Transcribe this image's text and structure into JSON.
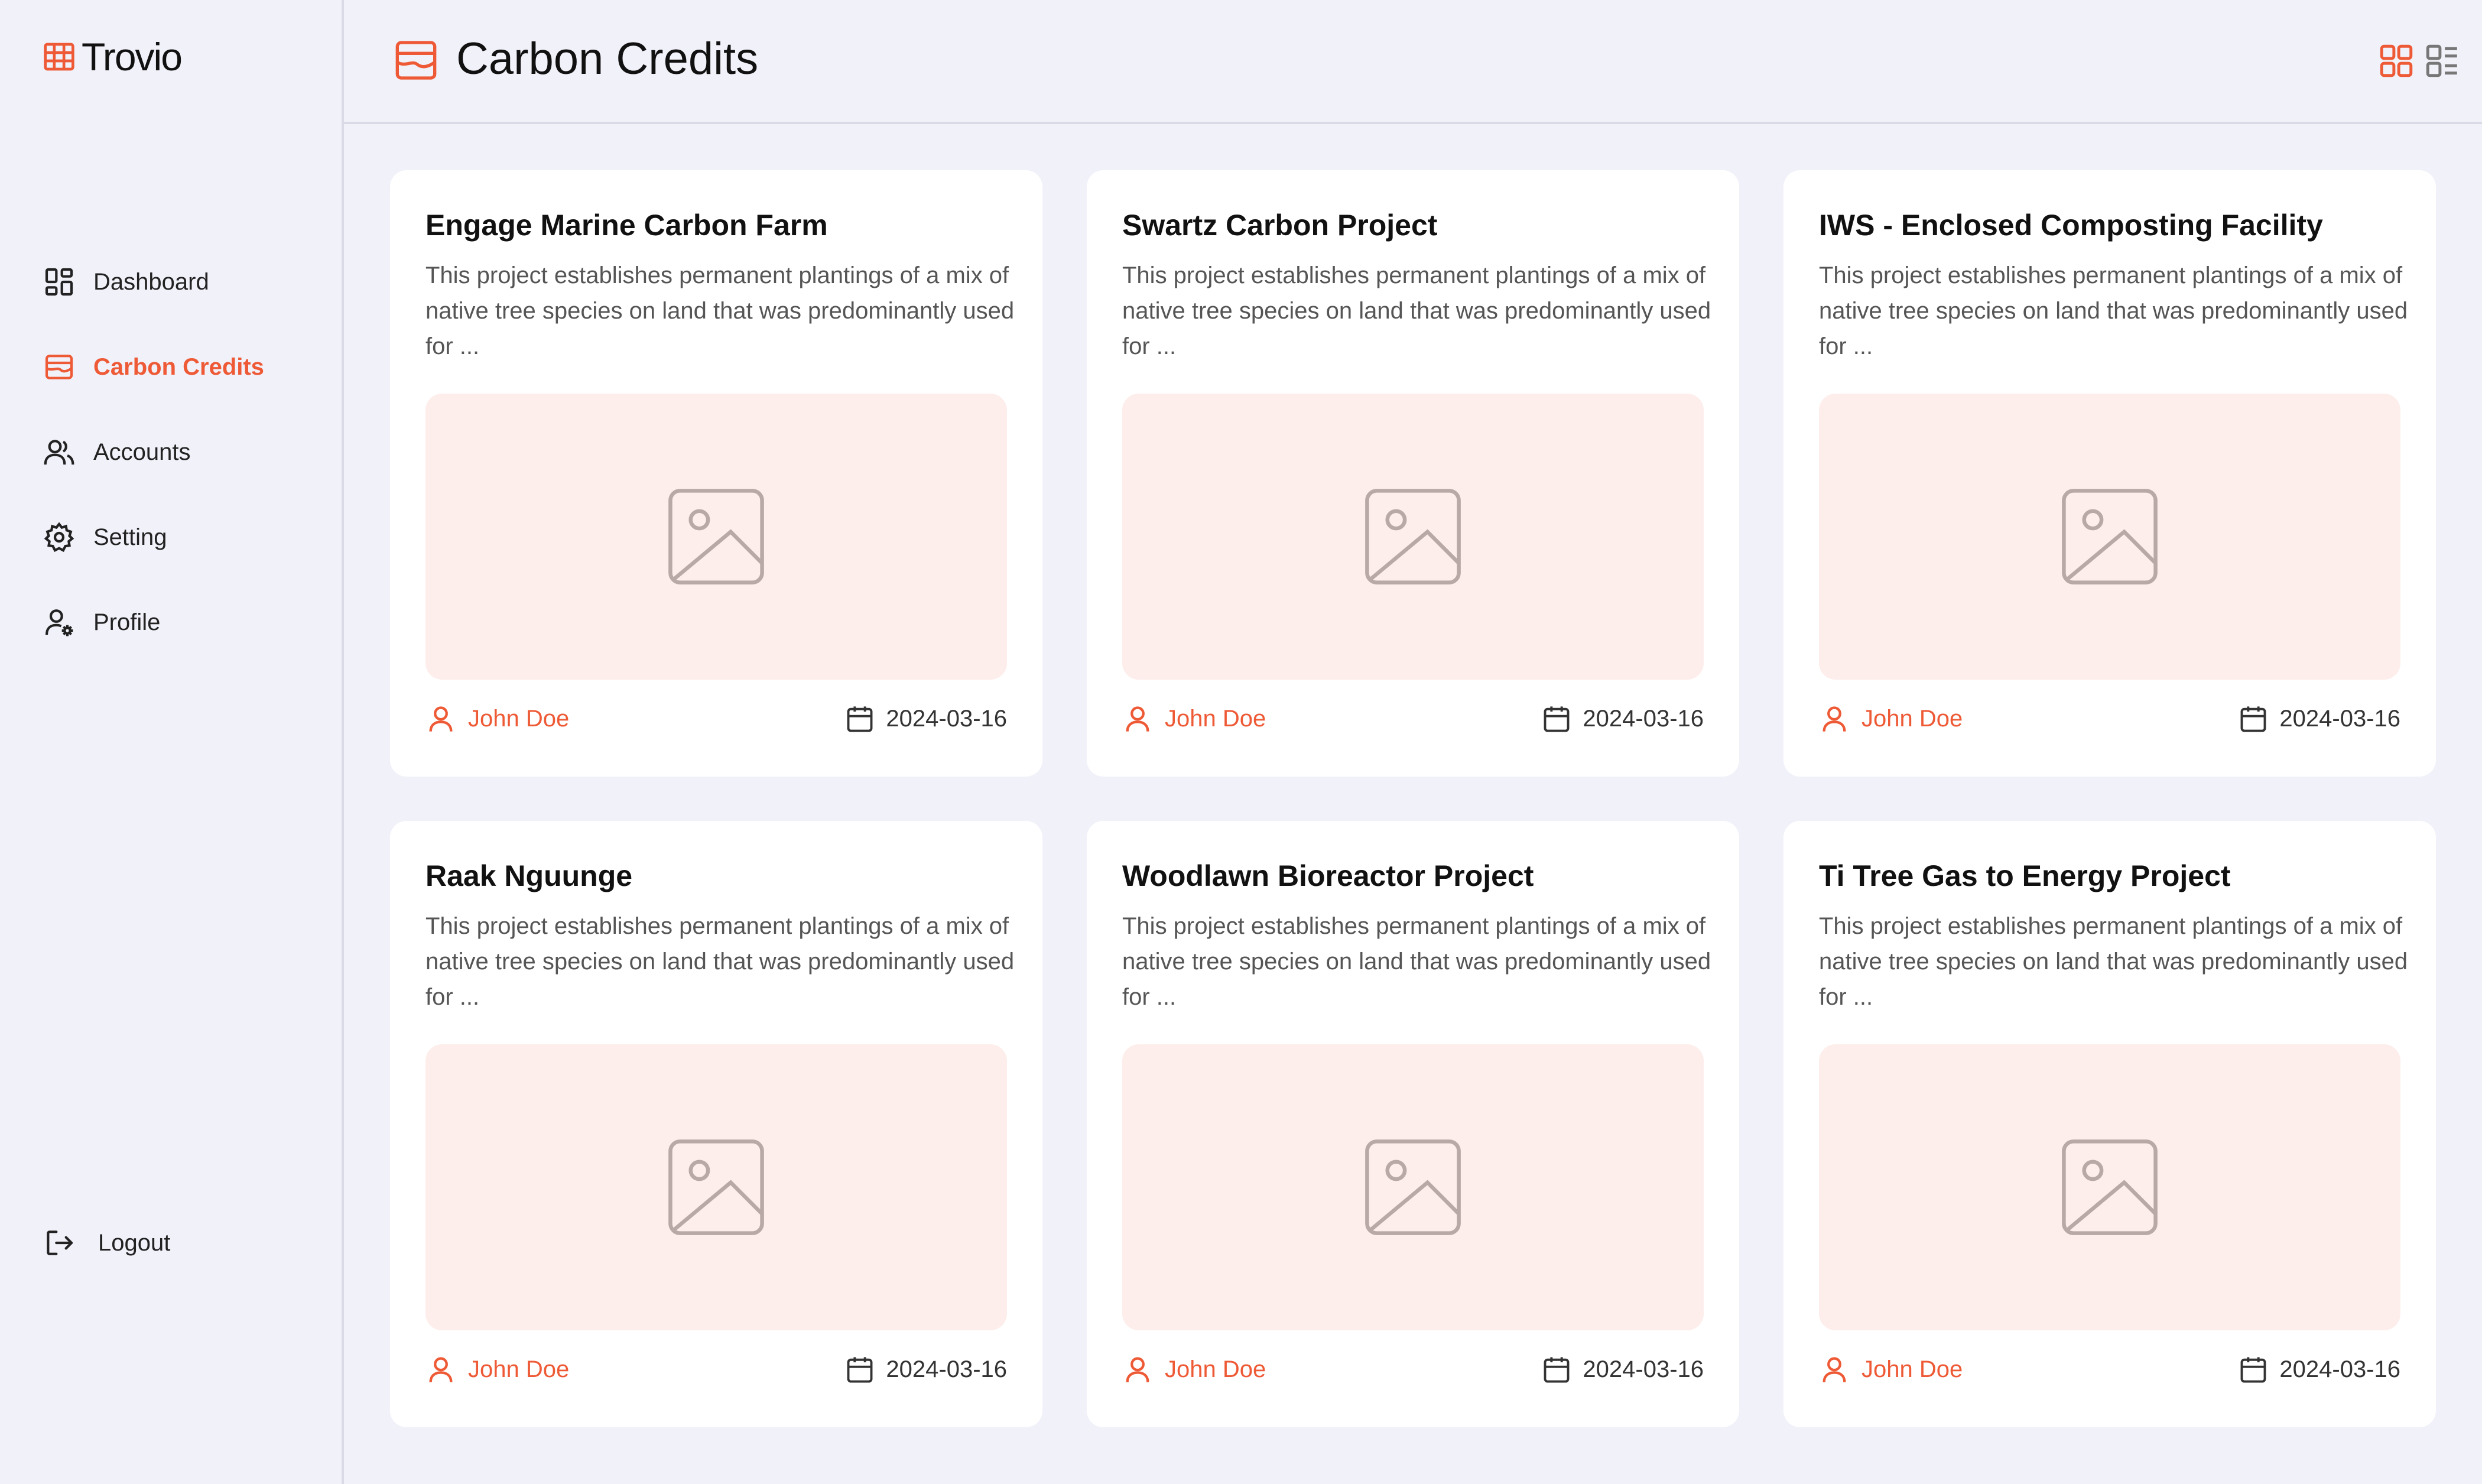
{
  "app": {
    "name": "Trovio",
    "accent_color": "#EE5A36"
  },
  "sidebar": {
    "items": [
      {
        "label": "Dashboard",
        "icon": "dashboard-icon"
      },
      {
        "label": "Carbon Credits",
        "icon": "carbon-credits-icon",
        "active": true
      },
      {
        "label": "Accounts",
        "icon": "users-icon"
      },
      {
        "label": "Setting",
        "icon": "gear-icon"
      },
      {
        "label": "Profile",
        "icon": "user-settings-icon"
      }
    ],
    "logout_label": "Logout"
  },
  "header": {
    "title": "Carbon Credits",
    "view_modes": [
      "grid-view-icon",
      "list-view-icon"
    ],
    "active_view": "grid"
  },
  "cards": [
    {
      "title": "Engage Marine Carbon Farm",
      "description": "This project establishes permanent plantings of a mix of native tree species on land that was predominantly used for ...",
      "author": "John Doe",
      "date": "2024-03-16"
    },
    {
      "title": "Swartz Carbon Project",
      "description": "This project establishes permanent plantings of a mix of native tree species on land that was predominantly used for ...",
      "author": "John Doe",
      "date": "2024-03-16"
    },
    {
      "title": "IWS - Enclosed Composting Facility",
      "description": "This project establishes permanent plantings of a mix of native tree species on land that was predominantly used for ...",
      "author": "John Doe",
      "date": "2024-03-16"
    },
    {
      "title": "Raak Nguunge",
      "description": "This project establishes permanent plantings of a mix of native tree species on land that was predominantly used for ...",
      "author": "John Doe",
      "date": "2024-03-16"
    },
    {
      "title": "Woodlawn Bioreactor Project",
      "description": "This project establishes permanent plantings of a mix of native tree species on land that was predominantly used for ...",
      "author": "John Doe",
      "date": "2024-03-16"
    },
    {
      "title": "Ti Tree Gas to Energy Project",
      "description": "This project establishes permanent plantings of a mix of native tree species on land that was predominantly used for ...",
      "author": "John Doe",
      "date": "2024-03-16"
    }
  ]
}
